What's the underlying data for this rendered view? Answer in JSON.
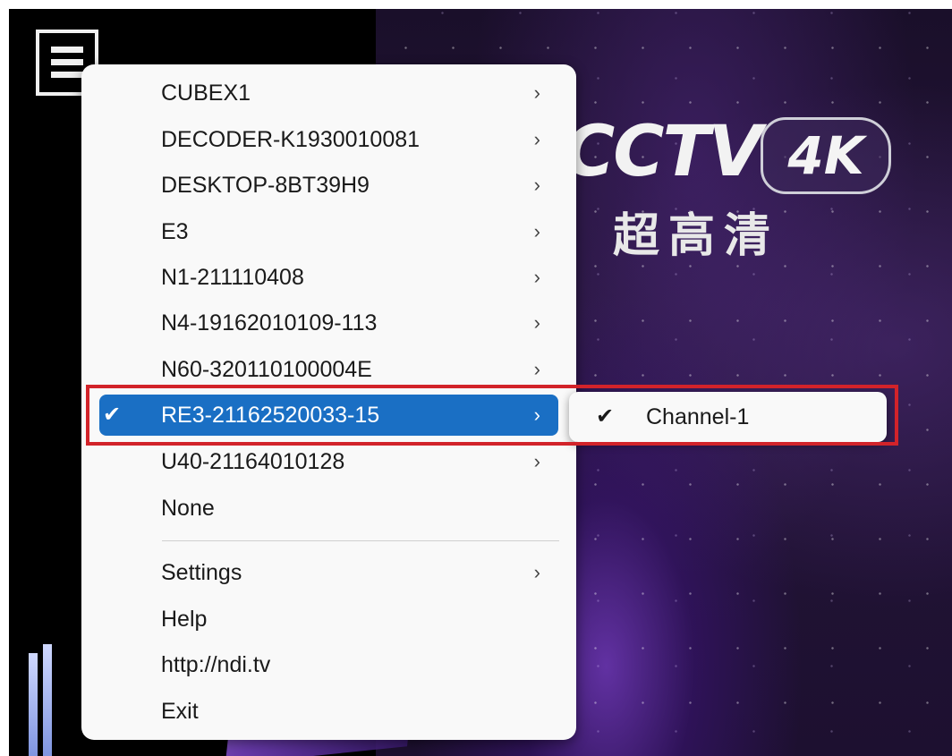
{
  "background": {
    "logo_text": "CCTV",
    "logo_badge": "4K",
    "logo_subtitle": "超高清"
  },
  "menu": {
    "items": [
      {
        "label": "CUBEX1",
        "submenu": true
      },
      {
        "label": "DECODER-K1930010081",
        "submenu": true
      },
      {
        "label": "DESKTOP-8BT39H9",
        "submenu": true
      },
      {
        "label": "E3",
        "submenu": true
      },
      {
        "label": "N1-211110408",
        "submenu": true
      },
      {
        "label": "N4-19162010109-113",
        "submenu": true
      },
      {
        "label": "N60-320110100004E",
        "submenu": true
      },
      {
        "label": "RE3-21162520033-15",
        "submenu": true,
        "selected": true,
        "checked": true
      },
      {
        "label": "U40-21164010128",
        "submenu": true
      },
      {
        "label": "None",
        "submenu": false
      }
    ],
    "footer_items": [
      {
        "label": "Settings",
        "submenu": true
      },
      {
        "label": "Help",
        "submenu": false
      },
      {
        "label": "http://ndi.tv",
        "submenu": false
      },
      {
        "label": "Exit",
        "submenu": false
      }
    ],
    "arrow_glyph": "›",
    "check_glyph": "✔"
  },
  "submenu": {
    "check_glyph": "✔",
    "label": "Channel-1"
  },
  "colors": {
    "selection": "#1a6fc4",
    "highlight": "#d2232a",
    "menu_bg": "#f9f9f9"
  }
}
